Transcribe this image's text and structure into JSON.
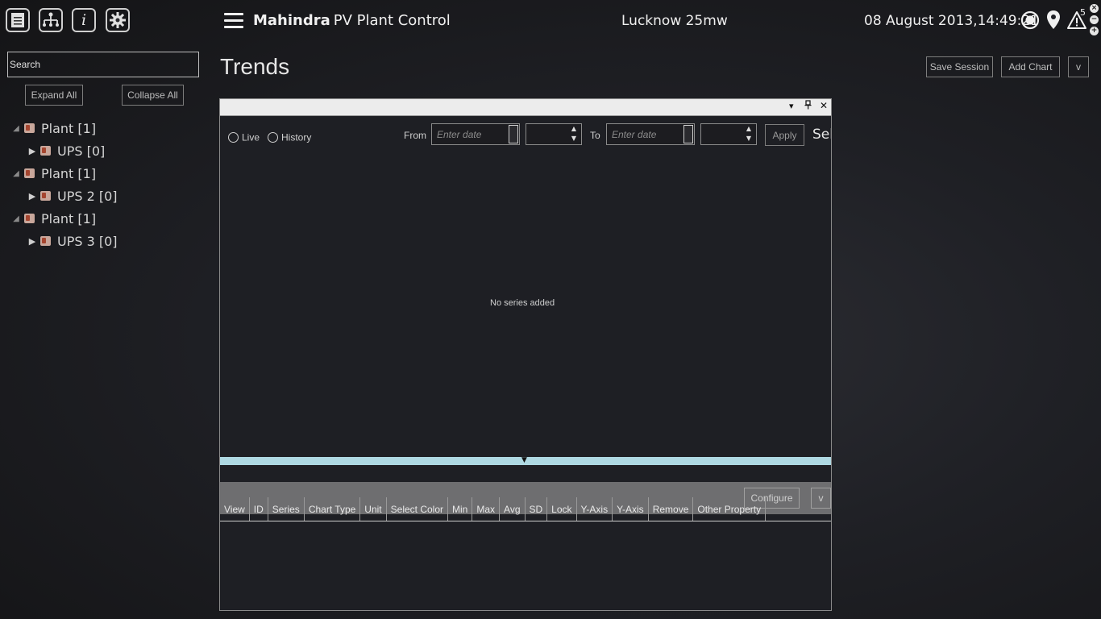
{
  "toolbar": {
    "icons": [
      "document-icon",
      "hierarchy-icon",
      "info-icon",
      "gear-icon"
    ]
  },
  "header": {
    "brand_bold": "Mahindra",
    "brand_rest": "PV Plant Control",
    "site": "Lucknow 25mw",
    "datetime": "08 August 2013,14:49:21",
    "alert_count": "5"
  },
  "sidebar": {
    "search_value": "Search",
    "expand_all": "Expand All",
    "collapse_all": "Collapse All",
    "tree": [
      {
        "label": "Plant [1]",
        "child": "UPS [0]"
      },
      {
        "label": "Plant [1]",
        "child": "UPS 2 [0]"
      },
      {
        "label": "Plant [1]",
        "child": "UPS 3 [0]"
      }
    ]
  },
  "main": {
    "title": "Trends",
    "save_session": "Save Session",
    "add_chart": "Add Chart",
    "more": "v"
  },
  "chart_panel": {
    "live": "Live",
    "history": "History",
    "from": "From",
    "to": "To",
    "date_placeholder": "Enter date",
    "apply": "Apply",
    "select_cut": "Sele",
    "empty_message": "No series added",
    "configure": "Configure",
    "configure_more": "v",
    "columns": [
      "View",
      "ID",
      "Series",
      "Chart Type",
      "Unit",
      "Select Color",
      "Min",
      "Max",
      "Avg",
      "SD",
      "Lock",
      "Y-Axis",
      "Y-Axis",
      "Remove",
      "Other Property"
    ]
  }
}
